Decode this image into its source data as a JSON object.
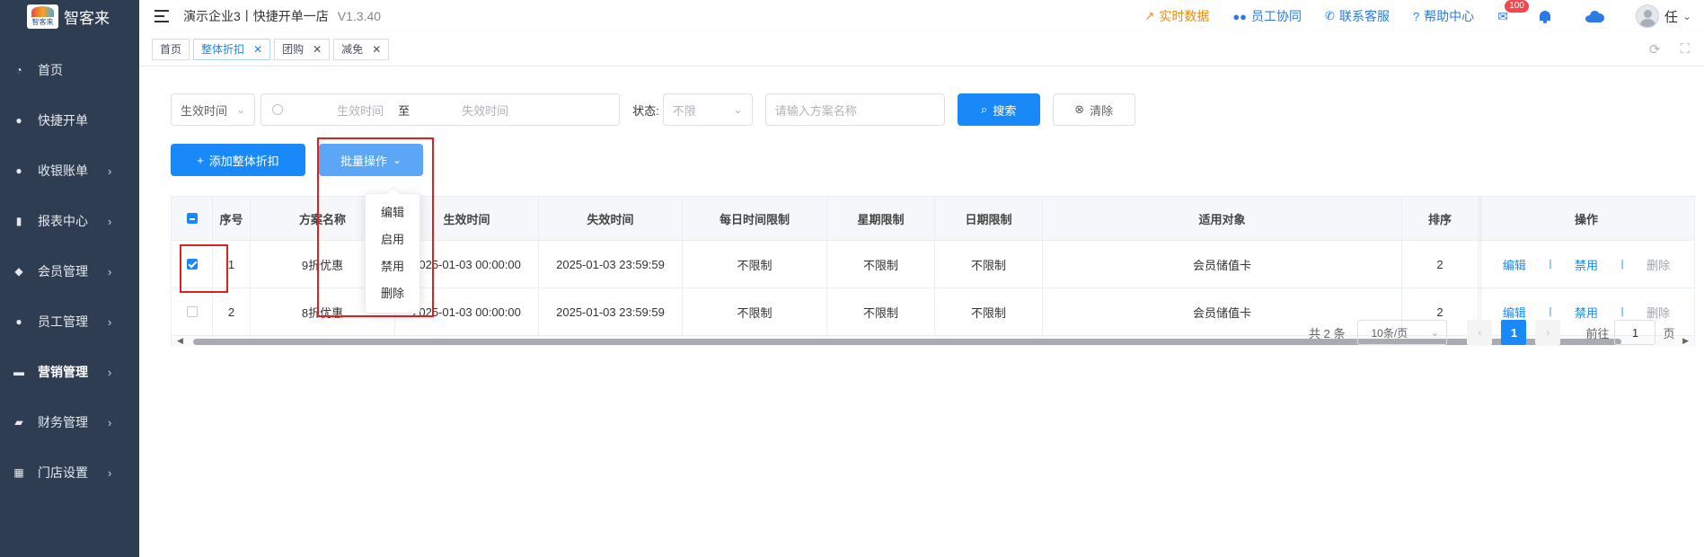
{
  "brand": {
    "logo_text": "智客来",
    "logo_mini": "智客来"
  },
  "sidebar": {
    "items": [
      {
        "label": "首页",
        "icon": "dashboard-icon",
        "arrow": ""
      },
      {
        "label": "快捷开单",
        "icon": "moneybag-icon",
        "arrow": ""
      },
      {
        "label": "收银账单",
        "icon": "moneybag-icon",
        "arrow": "›"
      },
      {
        "label": "报表中心",
        "icon": "bar-chart-icon",
        "arrow": "›"
      },
      {
        "label": "会员管理",
        "icon": "diamond-icon",
        "arrow": "›"
      },
      {
        "label": "员工管理",
        "icon": "user-icon",
        "arrow": "›"
      },
      {
        "label": "营销管理",
        "icon": "briefcase-icon",
        "arrow": "›"
      },
      {
        "label": "财务管理",
        "icon": "wallet-icon",
        "arrow": "›"
      },
      {
        "label": "门店设置",
        "icon": "grid-icon",
        "arrow": "›"
      }
    ]
  },
  "header": {
    "title": "演示企业3丨快捷开单一店",
    "version": "V1.3.40",
    "links": {
      "realtime": "实时数据",
      "staff": "员工协同",
      "support": "联系客服",
      "help": "帮助中心"
    },
    "mail_badge": "100",
    "user_name": "任"
  },
  "tabs": [
    {
      "label": "首页",
      "closable": false
    },
    {
      "label": "整体折扣",
      "closable": true
    },
    {
      "label": "团购",
      "closable": true
    },
    {
      "label": "减免",
      "closable": true
    }
  ],
  "filters": {
    "time_type": "生效时间",
    "start_placeholder": "生效时间",
    "range_sep": "至",
    "end_placeholder": "失效时间",
    "status_label": "状态:",
    "status_value": "不限",
    "name_placeholder": "请输入方案名称",
    "search_label": "搜索",
    "clear_label": "清除"
  },
  "actions": {
    "add_label": "添加整体折扣",
    "batch_label": "批量操作",
    "batch_menu": [
      "编辑",
      "启用",
      "禁用",
      "删除"
    ]
  },
  "table": {
    "headers": [
      "序号",
      "方案名称",
      "生效时间",
      "失效时间",
      "每日时间限制",
      "星期限制",
      "日期限制",
      "适用对象",
      "排序",
      "操作"
    ],
    "rows": [
      {
        "checked": true,
        "no": "1",
        "name": "9折优惠",
        "start": "2025-01-03 00:00:00",
        "end": "2025-01-03 23:59:59",
        "daily": "不限制",
        "week": "不限制",
        "date": "不限制",
        "target": "会员储值卡",
        "sort": "2"
      },
      {
        "checked": false,
        "no": "2",
        "name": "8折优惠",
        "start": "2025-01-03 00:00:00",
        "end": "2025-01-03 23:59:59",
        "daily": "不限制",
        "week": "不限制",
        "date": "不限制",
        "target": "会员储值卡",
        "sort": "2"
      }
    ],
    "ops": {
      "edit": "编辑",
      "disable": "禁用",
      "delete": "删除",
      "sep": "|"
    }
  },
  "pagination": {
    "total": "共 2 条",
    "page_size": "10条/页",
    "current": "1",
    "goto_label": "前往",
    "goto_value": "1",
    "page_suffix": "页"
  },
  "colors": {
    "primary": "#1989fa",
    "sidebar_bg": "#2f3d52",
    "highlight_box": "#e02020",
    "realtime_orange": "#f08a00"
  }
}
